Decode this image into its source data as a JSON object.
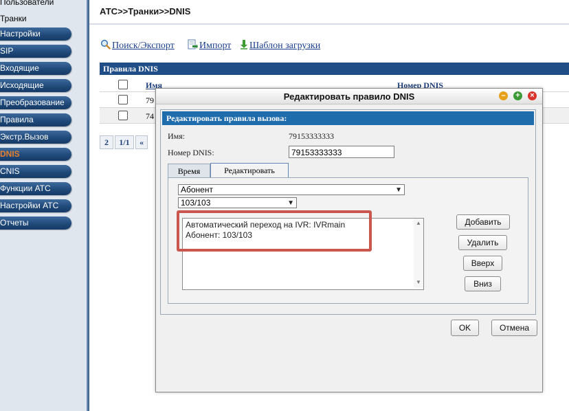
{
  "sidebar": {
    "items": [
      {
        "label": "Пользователи"
      },
      {
        "label": "Транки"
      },
      {
        "label": "Настройки"
      },
      {
        "label": "SIP"
      },
      {
        "label": "Входящие"
      },
      {
        "label": "Исходящие"
      },
      {
        "label": "Преобразование"
      },
      {
        "label": "Правила"
      },
      {
        "label": "Экстр.Вызов"
      },
      {
        "label": "DNIS"
      },
      {
        "label": "CNIS"
      },
      {
        "label": "Функции АТС"
      },
      {
        "label": "Настройки АТС"
      },
      {
        "label": "Отчеты"
      }
    ],
    "active_item": "DNIS",
    "active_color": "#e87f2c"
  },
  "breadcrumb": "АТС>>Транки>>DNIS",
  "toolbar": {
    "search_export": "Поиск/Экспорт",
    "import": "Импорт",
    "upload_template": "Шаблон загрузки"
  },
  "rules_table": {
    "title": "Правила DNIS",
    "columns": [
      "Имя",
      "Номер DNIS"
    ],
    "rows": [
      {
        "name": "79"
      },
      {
        "name": "74"
      }
    ]
  },
  "pager": {
    "page": "2",
    "pages": "1/1",
    "first": "«"
  },
  "dialog": {
    "title": "Редактировать правило DNIS",
    "section_title": "Редактировать правила вызова:",
    "name_label": "Имя:",
    "name_value": "79153333333",
    "dnis_label": "Номер DNIS:",
    "dnis_value": "79153333333",
    "tabs": [
      {
        "label": "Время",
        "active": false
      },
      {
        "label": "Редактировать",
        "active": true
      }
    ],
    "select_type": "Абонент",
    "select_subscriber": "103/103",
    "rule_list": [
      "Автоматический переход на IVR: IVRmain",
      "Абонент: 103/103"
    ],
    "buttons": {
      "add": "Добавить",
      "delete": "Удалить",
      "up": "Вверх",
      "down": "Вниз"
    },
    "ok": "OK",
    "cancel": "Отмена"
  },
  "colors": {
    "header_blue": "#1f4e86",
    "section_blue": "#1f6cad",
    "highlight_red": "#c9574e"
  }
}
